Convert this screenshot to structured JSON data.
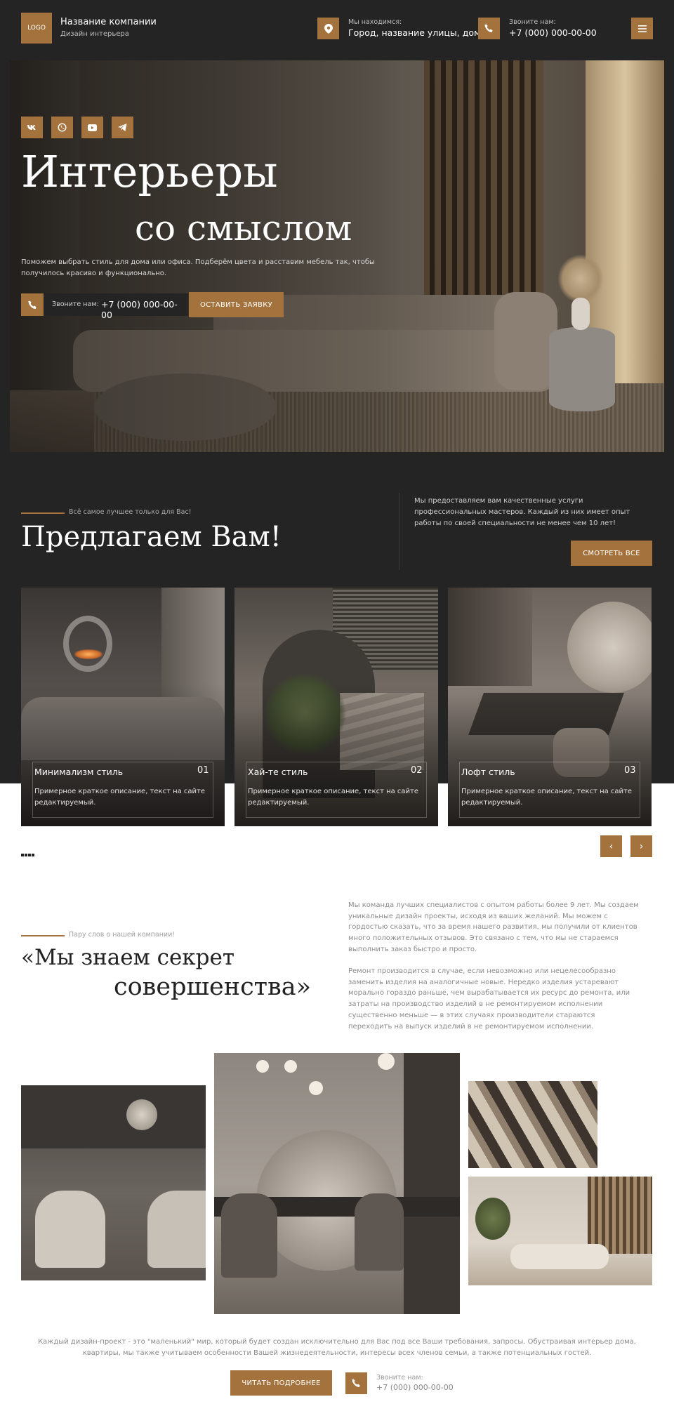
{
  "header": {
    "logo": "LOGO",
    "company_name": "Название компании",
    "company_sub": "Дизайн интерьера",
    "location_label": "Мы находимся:",
    "location_value": "Город, название улицы, дом",
    "phone_label": "Звоните нам:",
    "phone_value": "+7 (000) 000-00-00",
    "icons": [
      "location-pin-icon",
      "phone-icon",
      "menu-icon"
    ]
  },
  "hero": {
    "social": [
      "vk-icon",
      "whatsapp-icon",
      "youtube-icon",
      "telegram-icon"
    ],
    "title_line1": "Интерьеры",
    "title_line2": "со смыслом",
    "text": "Поможем выбрать стиль для дома или офиса. Подберём цвета и расставим мебель так, чтобы получилось красиво и функционально.",
    "call_label": "Звоните нам:",
    "call_phone": "+7 (000) 000-00-00",
    "cta": "ОСТАВИТЬ ЗАЯВКУ"
  },
  "offer": {
    "eyebrow": "Всё самое лучшее только для Вас!",
    "title": "Предлагаем Вам!",
    "text": "Мы предоставляем вам качественные услуги профессиональных мастеров. Каждый из них имеет опыт работы по своей специальности не менее чем 10 лет!",
    "button": "СМОТРЕТЬ ВСЕ",
    "cards": [
      {
        "title": "Минимализм стиль",
        "num": "01",
        "desc": "Примерное краткое описание, текст на сайте редактируемый."
      },
      {
        "title": "Хай-те стиль",
        "num": "02",
        "desc": "Примерное краткое описание, текст на сайте редактируемый."
      },
      {
        "title": "Лофт стиль",
        "num": "03",
        "desc": "Примерное краткое описание, текст на сайте редактируемый."
      }
    ],
    "prev": "‹",
    "next": "›"
  },
  "about": {
    "eyebrow": "Пару слов о нашей компании!",
    "title_line1": "«Мы знаем секрет",
    "title_line2": "совершенства»",
    "p1": "Мы команда лучших специалистов с опытом работы более 9 лет. Мы создаем уникальные дизайн проекты, исходя из ваших желаний. Мы можем с гордостью сказать, что за время нашего развития, мы получили от клиентов много положительных отзывов. Это связано с тем, что мы не стараемся выполнить заказ быстро и просто.",
    "p2": "Ремонт производится в случае, если невозможно или нецелесообразно заменить изделия на аналогичные новые. Нередко изделия устаревают морально гораздо раньше, чем вырабатывается их ресурс до ремонта, или затраты на производство изделий в не ремонтируемом исполнении существенно меньше — в этих случаях производители стараются переходить на выпуск изделий в не ремонтируемом исполнении."
  },
  "footer": {
    "text": "Каждый дизайн-проект - это \"маленький\" мир, который будет создан исключительно для Вас под все Ваши требования, запросы. Обустраивая интерьер дома, квартиры, мы также учитываем особенности Вашей жизнедеятельности, интересы всех членов семьи, а также потенциальных гостей.",
    "button": "ЧИТАТЬ ПОДРОБНЕЕ",
    "phone_label": "Звоните нам:",
    "phone_value": "+7 (000) 000-00-00"
  },
  "colors": {
    "accent": "#a4733d",
    "dark": "#242424"
  }
}
